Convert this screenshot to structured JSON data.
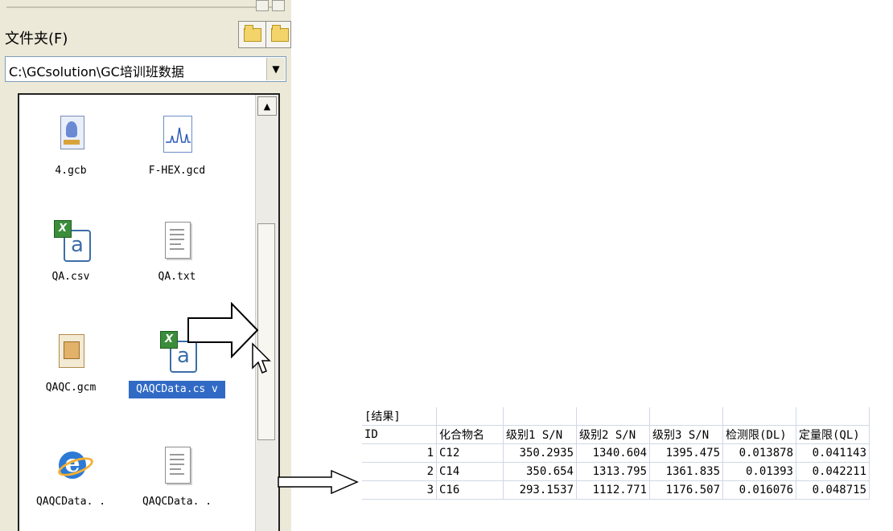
{
  "folder_label": "文件夹(F)",
  "path": "C:\\GCsolution\\GC培训班数据",
  "files": [
    {
      "name": "4.gcb",
      "icon": "gcb-file-icon",
      "selected": false
    },
    {
      "name": "F-HEX.gcd",
      "icon": "chromatogram-file-icon",
      "selected": false
    },
    {
      "name": "QA.csv",
      "icon": "excel-csv-icon",
      "selected": false
    },
    {
      "name": "QA.txt",
      "icon": "text-file-icon",
      "selected": false
    },
    {
      "name": "QAQC.gcm",
      "icon": "gcm-file-icon",
      "selected": false
    },
    {
      "name": "QAQCData.cs v",
      "icon": "excel-csv-icon",
      "selected": true
    },
    {
      "name": "QAQCData. .",
      "icon": "internet-explorer-icon",
      "selected": false
    },
    {
      "name": "QAQCData. .",
      "icon": "text-file-icon",
      "selected": false
    }
  ],
  "sheet": {
    "title": "[结果]",
    "headers": [
      "ID",
      "化合物名",
      "级别1 S/N",
      "级别2 S/N",
      "级别3 S/N",
      "检测限(DL)",
      "定量限(QL)"
    ],
    "rows": [
      [
        "1",
        "C12",
        "350.2935",
        "1340.604",
        "1395.475",
        "0.013878",
        "0.041143"
      ],
      [
        "2",
        "C14",
        "350.654",
        "1313.795",
        "1361.835",
        "0.01393",
        "0.042211"
      ],
      [
        "3",
        "C16",
        "293.1537",
        "1112.771",
        "1176.507",
        "0.016076",
        "0.048715"
      ]
    ]
  }
}
